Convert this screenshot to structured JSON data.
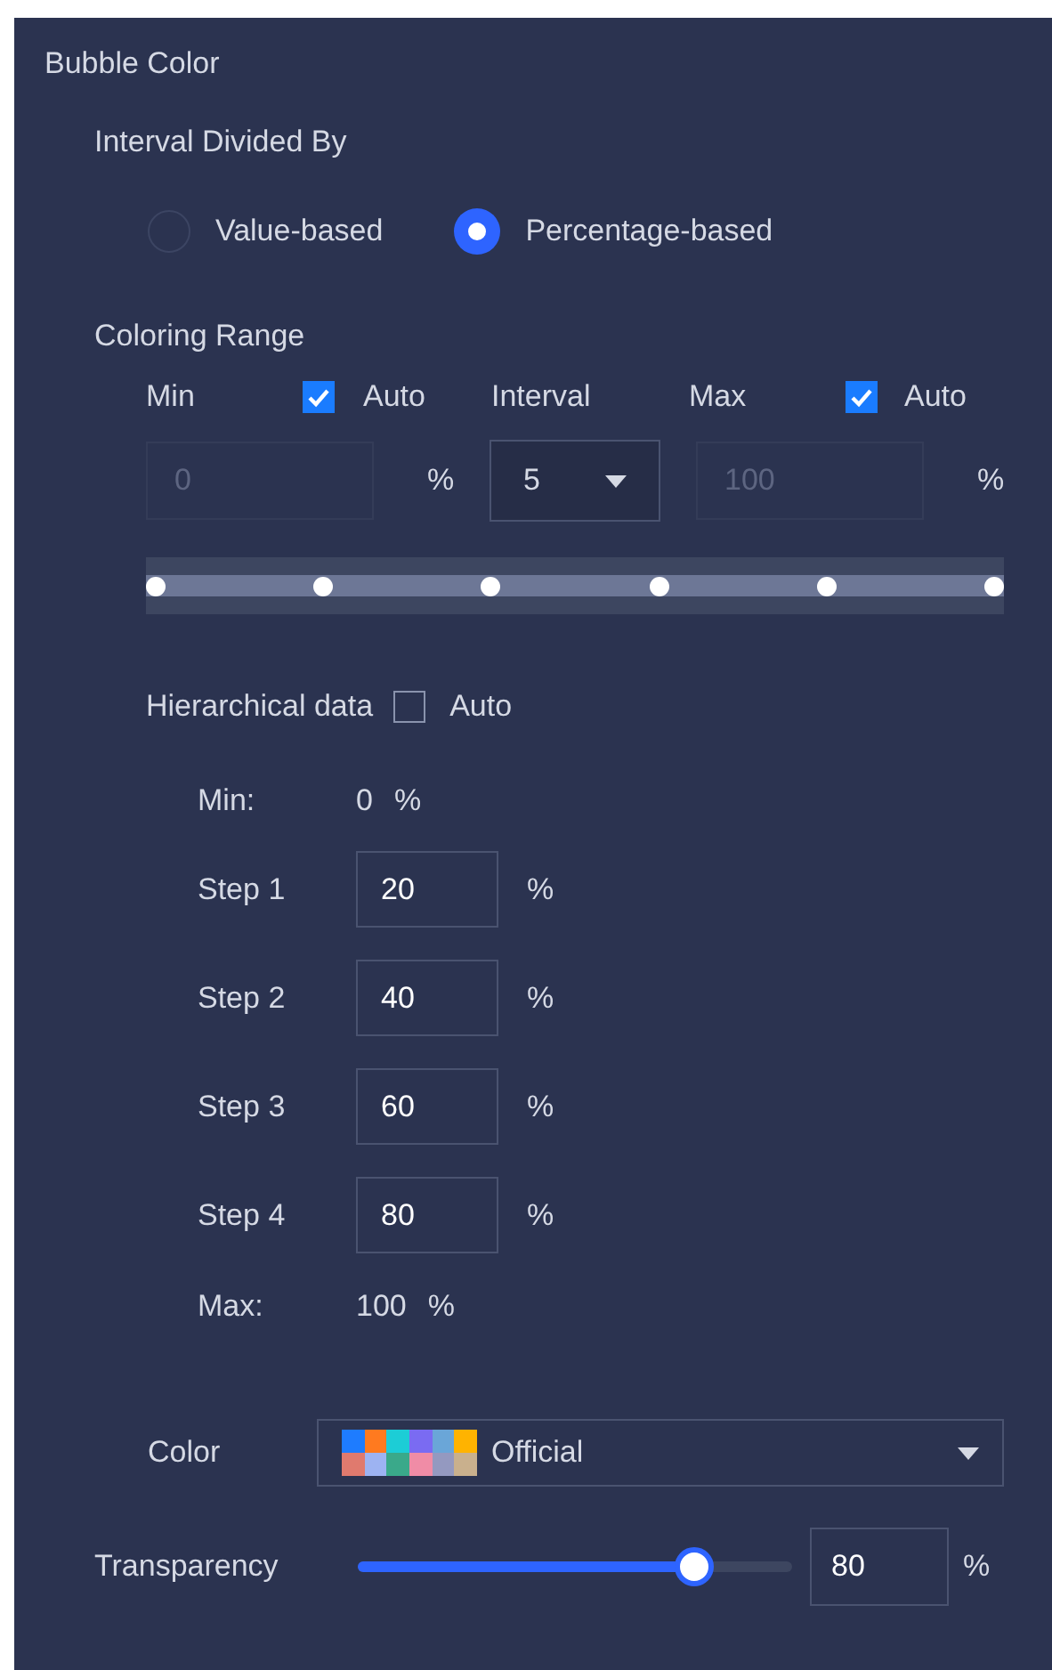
{
  "panel": {
    "title": "Bubble Color"
  },
  "interval_divided_by": {
    "label": "Interval Divided By",
    "options": [
      {
        "label": "Value-based",
        "selected": false
      },
      {
        "label": "Percentage-based",
        "selected": true
      }
    ]
  },
  "coloring_range": {
    "label": "Coloring Range",
    "min": {
      "label": "Min",
      "auto_label": "Auto",
      "auto": true,
      "value": "0",
      "unit": "%"
    },
    "interval": {
      "label": "Interval",
      "value": "5"
    },
    "max": {
      "label": "Max",
      "auto_label": "Auto",
      "auto": true,
      "value": "100",
      "unit": "%"
    },
    "stops": [
      {
        "level": 0
      },
      {
        "level": 0.2
      },
      {
        "level": 0.4
      },
      {
        "level": 0.6
      },
      {
        "level": 0.8
      },
      {
        "level": 1
      }
    ]
  },
  "hierarchical": {
    "label": "Hierarchical data",
    "auto_label": "Auto",
    "auto": false,
    "min": {
      "label": "Min:",
      "value": "0",
      "unit": "%"
    },
    "steps": [
      {
        "label": "Step 1",
        "value": "20",
        "unit": "%"
      },
      {
        "label": "Step 2",
        "value": "40",
        "unit": "%"
      },
      {
        "label": "Step 3",
        "value": "60",
        "unit": "%"
      },
      {
        "label": "Step 4",
        "value": "80",
        "unit": "%"
      }
    ],
    "max": {
      "label": "Max:",
      "value": "100",
      "unit": "%"
    }
  },
  "color": {
    "label": "Color",
    "value": "Official",
    "swatches": [
      {
        "color": "#1e7cff"
      },
      {
        "color": "#ff7a1f"
      },
      {
        "color": "#1ccdd6"
      },
      {
        "color": "#7a6bf2"
      },
      {
        "color": "#6aa6d8"
      },
      {
        "color": "#ffb300"
      },
      {
        "color": "#e07a6e"
      },
      {
        "color": "#9db3f2"
      },
      {
        "color": "#3aa98a"
      },
      {
        "color": "#f08ca6"
      },
      {
        "color": "#9499c0"
      },
      {
        "color": "#c9b08d"
      }
    ]
  },
  "transparency": {
    "label": "Transparency",
    "level": 0.8,
    "value": "80",
    "unit": "%"
  }
}
